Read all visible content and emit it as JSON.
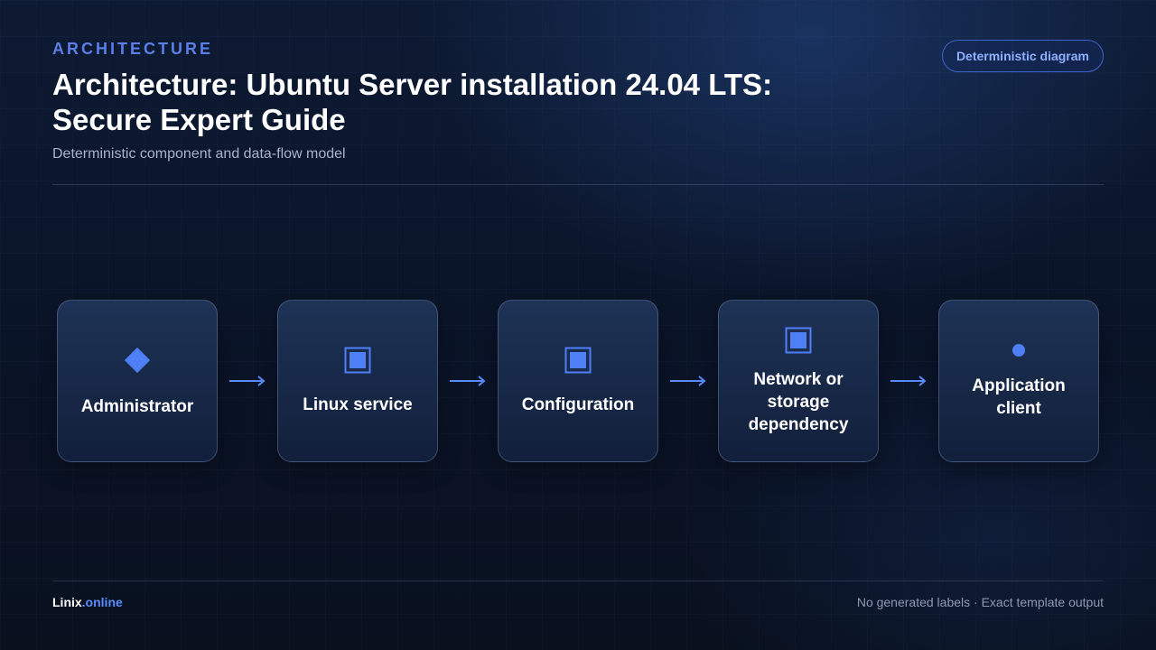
{
  "header": {
    "eyebrow": "ARCHITECTURE",
    "title": "Architecture: Ubuntu Server installation 24.04 LTS: Secure Expert Guide",
    "subtitle": "Deterministic component and data-flow model",
    "badge": "Deterministic diagram"
  },
  "diagram": {
    "nodes": [
      {
        "label": "Administrator",
        "icon": "diamond-icon"
      },
      {
        "label": "Linux service",
        "icon": "square-icon"
      },
      {
        "label": "Configuration",
        "icon": "square-icon"
      },
      {
        "label": "Network or storage dependency",
        "icon": "square-icon"
      },
      {
        "label": "Application client",
        "icon": "circle-icon"
      }
    ],
    "edges": [
      {
        "from": "Administrator",
        "to": "Linux service"
      },
      {
        "from": "Linux service",
        "to": "Configuration"
      },
      {
        "from": "Configuration",
        "to": "Network or storage dependency"
      },
      {
        "from": "Network or storage dependency",
        "to": "Application client"
      }
    ]
  },
  "footer": {
    "brand_main": "Linix",
    "brand_accent": ".online",
    "note": "No generated labels · Exact template output"
  },
  "colors": {
    "accent": "#5b8cff",
    "eyebrow": "#5b7fe8",
    "background": "#0b1428",
    "node_border": "#4a5f85"
  }
}
